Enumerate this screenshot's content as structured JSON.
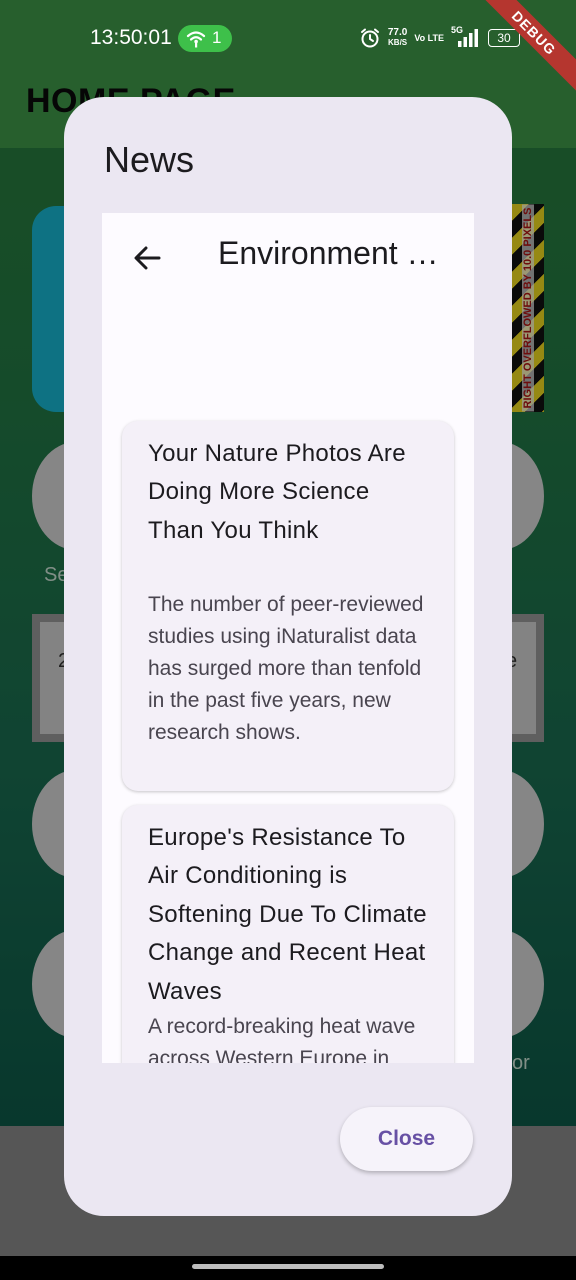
{
  "status_bar": {
    "time": "13:50:01",
    "hotspot_count": "1",
    "speed_value": "77.0",
    "speed_unit": "KB/S",
    "volte": "Vo LTE",
    "network": "5G",
    "battery": "30"
  },
  "debug_banner": "DEBUG",
  "background_app": {
    "title": "HOME PAGE",
    "overflow_warning": "RIGHT OVERFLOWED BY 10.0 PIXELS",
    "fragments": [
      "Se",
      "2",
      "e",
      "or"
    ]
  },
  "dialog": {
    "title": "News",
    "close_label": "Close",
    "inner_title": "Environment News",
    "articles": [
      {
        "headline": "Your Nature Photos Are Doing More Science Than You Think",
        "summary": "The number of peer-reviewed studies using iNaturalist data has surged more than tenfold in the past five years, new research shows."
      },
      {
        "headline": "Europe's Resistance To Air Conditioning is Softening Due To Climate Change and Recent Heat Waves",
        "summary": "A record-breaking heat wave across Western Europe in June and July has triggered a political battle over air conditioning."
      }
    ]
  },
  "colors": {
    "dialog_bg": "#ebe7f2",
    "card_bg": "#f4f0f8",
    "accent": "#6750a4",
    "app_green": "#2c7f3b"
  }
}
